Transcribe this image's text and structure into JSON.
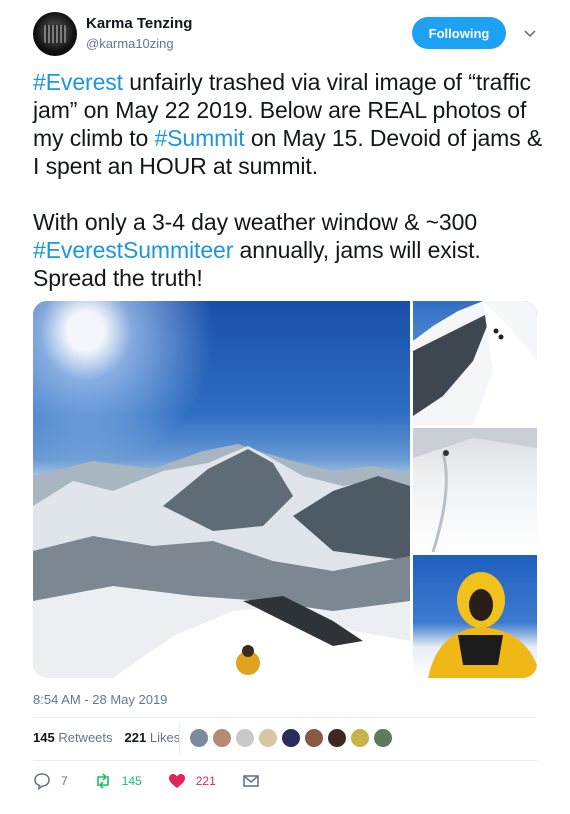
{
  "tweet": {
    "author_name": "Karma Tenzing",
    "author_handle": "@karma10zing",
    "follow_button": "Following",
    "text_para1": [
      {
        "t": "#Everest",
        "tag": true
      },
      {
        "t": " unfairly trashed via viral image of “traffic jam” on May 22 2019. Below are REAL photos of my climb to ",
        "tag": false
      },
      {
        "t": "#Summit",
        "tag": true
      },
      {
        "t": " on May 15. Devoid of jams & I spent an HOUR at summit.",
        "tag": false
      }
    ],
    "text_para2": [
      {
        "t": "With only a 3-4 day weather window & ~300 ",
        "tag": false
      },
      {
        "t": "#EverestSummiteer",
        "tag": true
      },
      {
        "t": " annually, jams will exist. Spread the truth!",
        "tag": false
      }
    ],
    "timestamp": "8:54 AM - 28 May 2019"
  },
  "stats": {
    "retweets_count": "145",
    "retweets_label": "Retweets",
    "likes_count": "221",
    "likes_label": "Likes",
    "liker_colors": [
      "#7a8c9c",
      "#b58a72",
      "#c9c9c9",
      "#d8c7a3",
      "#2b2b5c",
      "#8a5a44",
      "#3b2a22",
      "#c9b24a",
      "#5d7a5a"
    ]
  },
  "actions": {
    "reply_count": "7",
    "retweet_count": "145",
    "like_count": "221"
  },
  "colors": {
    "accent": "#1da1f2",
    "hashtag": "#1b95e0",
    "retweet_green": "#17bf63",
    "like_red": "#e0245e",
    "secondary_text": "#657786"
  }
}
